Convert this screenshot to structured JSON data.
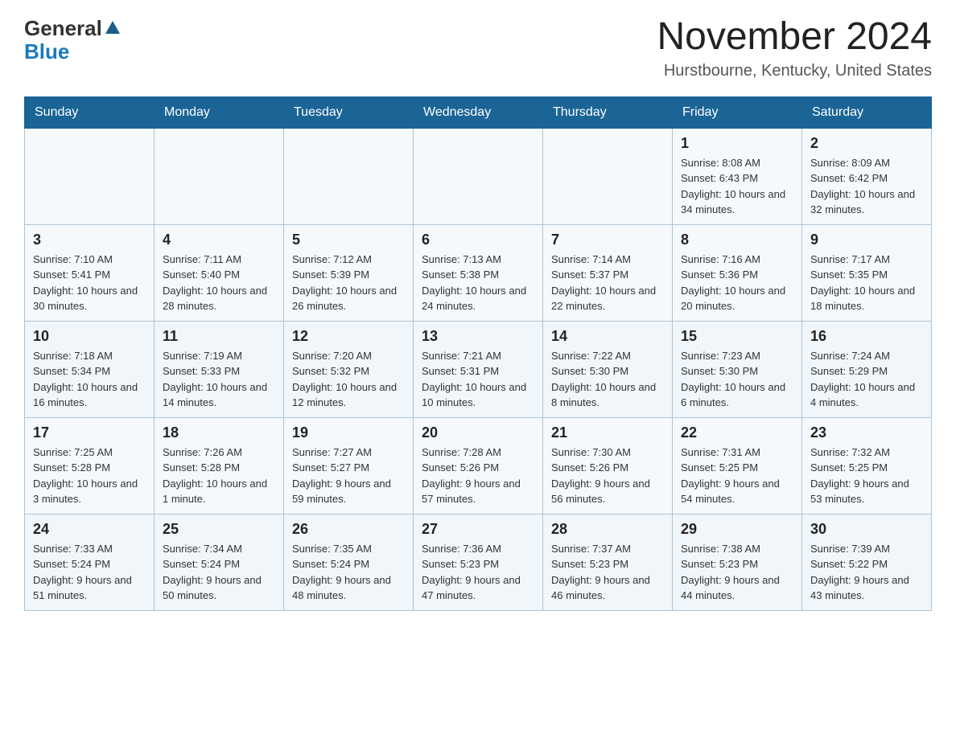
{
  "header": {
    "logo_general": "General",
    "logo_blue": "Blue",
    "title": "November 2024",
    "location": "Hurstbourne, Kentucky, United States"
  },
  "days_of_week": [
    "Sunday",
    "Monday",
    "Tuesday",
    "Wednesday",
    "Thursday",
    "Friday",
    "Saturday"
  ],
  "weeks": [
    [
      {
        "day": "",
        "info": ""
      },
      {
        "day": "",
        "info": ""
      },
      {
        "day": "",
        "info": ""
      },
      {
        "day": "",
        "info": ""
      },
      {
        "day": "",
        "info": ""
      },
      {
        "day": "1",
        "info": "Sunrise: 8:08 AM\nSunset: 6:43 PM\nDaylight: 10 hours and 34 minutes."
      },
      {
        "day": "2",
        "info": "Sunrise: 8:09 AM\nSunset: 6:42 PM\nDaylight: 10 hours and 32 minutes."
      }
    ],
    [
      {
        "day": "3",
        "info": "Sunrise: 7:10 AM\nSunset: 5:41 PM\nDaylight: 10 hours and 30 minutes."
      },
      {
        "day": "4",
        "info": "Sunrise: 7:11 AM\nSunset: 5:40 PM\nDaylight: 10 hours and 28 minutes."
      },
      {
        "day": "5",
        "info": "Sunrise: 7:12 AM\nSunset: 5:39 PM\nDaylight: 10 hours and 26 minutes."
      },
      {
        "day": "6",
        "info": "Sunrise: 7:13 AM\nSunset: 5:38 PM\nDaylight: 10 hours and 24 minutes."
      },
      {
        "day": "7",
        "info": "Sunrise: 7:14 AM\nSunset: 5:37 PM\nDaylight: 10 hours and 22 minutes."
      },
      {
        "day": "8",
        "info": "Sunrise: 7:16 AM\nSunset: 5:36 PM\nDaylight: 10 hours and 20 minutes."
      },
      {
        "day": "9",
        "info": "Sunrise: 7:17 AM\nSunset: 5:35 PM\nDaylight: 10 hours and 18 minutes."
      }
    ],
    [
      {
        "day": "10",
        "info": "Sunrise: 7:18 AM\nSunset: 5:34 PM\nDaylight: 10 hours and 16 minutes."
      },
      {
        "day": "11",
        "info": "Sunrise: 7:19 AM\nSunset: 5:33 PM\nDaylight: 10 hours and 14 minutes."
      },
      {
        "day": "12",
        "info": "Sunrise: 7:20 AM\nSunset: 5:32 PM\nDaylight: 10 hours and 12 minutes."
      },
      {
        "day": "13",
        "info": "Sunrise: 7:21 AM\nSunset: 5:31 PM\nDaylight: 10 hours and 10 minutes."
      },
      {
        "day": "14",
        "info": "Sunrise: 7:22 AM\nSunset: 5:30 PM\nDaylight: 10 hours and 8 minutes."
      },
      {
        "day": "15",
        "info": "Sunrise: 7:23 AM\nSunset: 5:30 PM\nDaylight: 10 hours and 6 minutes."
      },
      {
        "day": "16",
        "info": "Sunrise: 7:24 AM\nSunset: 5:29 PM\nDaylight: 10 hours and 4 minutes."
      }
    ],
    [
      {
        "day": "17",
        "info": "Sunrise: 7:25 AM\nSunset: 5:28 PM\nDaylight: 10 hours and 3 minutes."
      },
      {
        "day": "18",
        "info": "Sunrise: 7:26 AM\nSunset: 5:28 PM\nDaylight: 10 hours and 1 minute."
      },
      {
        "day": "19",
        "info": "Sunrise: 7:27 AM\nSunset: 5:27 PM\nDaylight: 9 hours and 59 minutes."
      },
      {
        "day": "20",
        "info": "Sunrise: 7:28 AM\nSunset: 5:26 PM\nDaylight: 9 hours and 57 minutes."
      },
      {
        "day": "21",
        "info": "Sunrise: 7:30 AM\nSunset: 5:26 PM\nDaylight: 9 hours and 56 minutes."
      },
      {
        "day": "22",
        "info": "Sunrise: 7:31 AM\nSunset: 5:25 PM\nDaylight: 9 hours and 54 minutes."
      },
      {
        "day": "23",
        "info": "Sunrise: 7:32 AM\nSunset: 5:25 PM\nDaylight: 9 hours and 53 minutes."
      }
    ],
    [
      {
        "day": "24",
        "info": "Sunrise: 7:33 AM\nSunset: 5:24 PM\nDaylight: 9 hours and 51 minutes."
      },
      {
        "day": "25",
        "info": "Sunrise: 7:34 AM\nSunset: 5:24 PM\nDaylight: 9 hours and 50 minutes."
      },
      {
        "day": "26",
        "info": "Sunrise: 7:35 AM\nSunset: 5:24 PM\nDaylight: 9 hours and 48 minutes."
      },
      {
        "day": "27",
        "info": "Sunrise: 7:36 AM\nSunset: 5:23 PM\nDaylight: 9 hours and 47 minutes."
      },
      {
        "day": "28",
        "info": "Sunrise: 7:37 AM\nSunset: 5:23 PM\nDaylight: 9 hours and 46 minutes."
      },
      {
        "day": "29",
        "info": "Sunrise: 7:38 AM\nSunset: 5:23 PM\nDaylight: 9 hours and 44 minutes."
      },
      {
        "day": "30",
        "info": "Sunrise: 7:39 AM\nSunset: 5:22 PM\nDaylight: 9 hours and 43 minutes."
      }
    ]
  ]
}
